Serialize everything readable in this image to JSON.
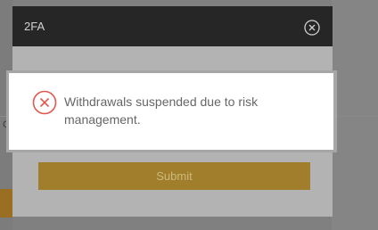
{
  "modal": {
    "title": "2FA",
    "submit_label": "Submit"
  },
  "background": {
    "partial_text": "C"
  },
  "toast": {
    "message": "Withdrawals suspended due to risk management.",
    "icon": "error-circle-x-icon",
    "accent_color": "#e0584f"
  },
  "icons": {
    "close": "close-circle-icon"
  }
}
